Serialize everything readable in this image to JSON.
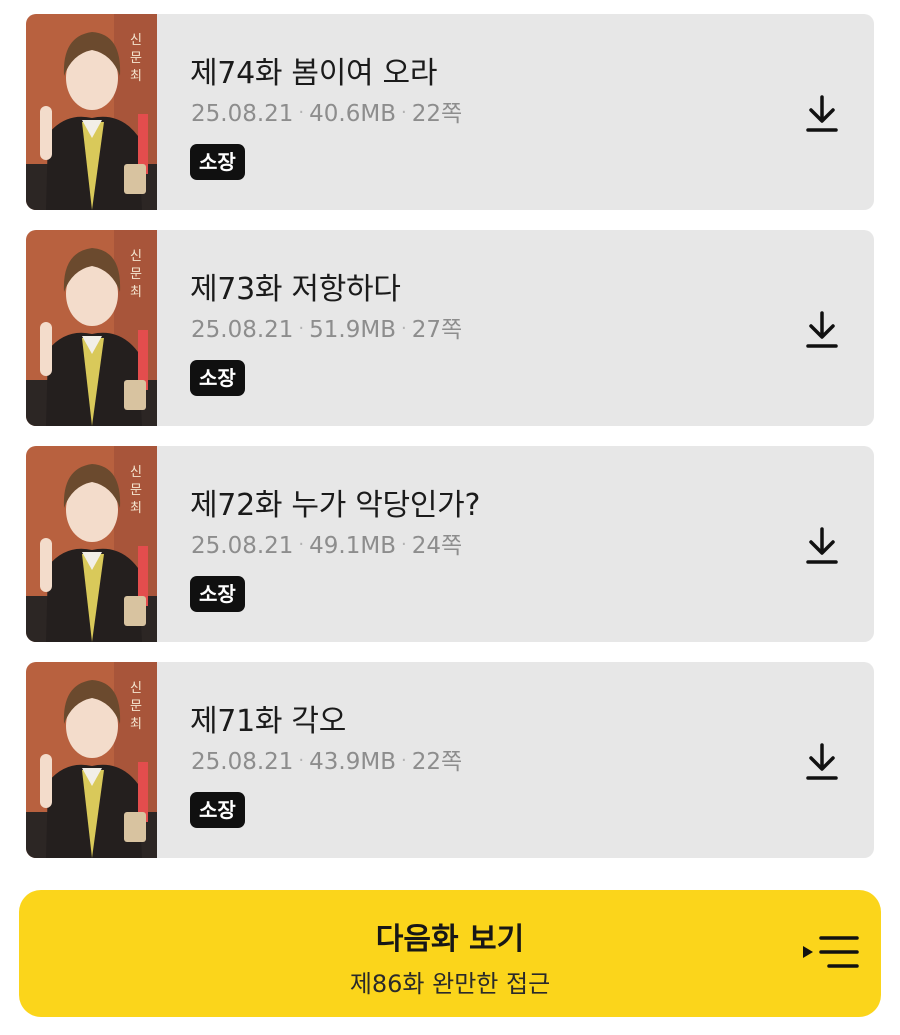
{
  "episodes": [
    {
      "title": "제74화 봄이여 오라",
      "date": "25.08.21",
      "size": "40.6MB",
      "pages": "22쪽",
      "badge": "소장",
      "thumbnail_icon": "manga-cover-image",
      "download_icon": "download-icon"
    },
    {
      "title": "제73화 저항하다",
      "date": "25.08.21",
      "size": "51.9MB",
      "pages": "27쪽",
      "badge": "소장",
      "thumbnail_icon": "manga-cover-image",
      "download_icon": "download-icon"
    },
    {
      "title": "제72화 누가 악당인가?",
      "date": "25.08.21",
      "size": "49.1MB",
      "pages": "24쪽",
      "badge": "소장",
      "thumbnail_icon": "manga-cover-image",
      "download_icon": "download-icon"
    },
    {
      "title": "제71화 각오",
      "date": "25.08.21",
      "size": "43.9MB",
      "pages": "22쪽",
      "badge": "소장",
      "thumbnail_icon": "manga-cover-image",
      "download_icon": "download-icon"
    }
  ],
  "meta_separator": "·",
  "next_button": {
    "label": "다음화 보기",
    "subtitle": "제86화 완만한 접근",
    "icon": "playlist-icon"
  },
  "colors": {
    "card_background": "#e7e7e7",
    "badge_background": "#101010",
    "accent_yellow": "#fbd51b",
    "meta_gray": "#8d8d8d"
  }
}
